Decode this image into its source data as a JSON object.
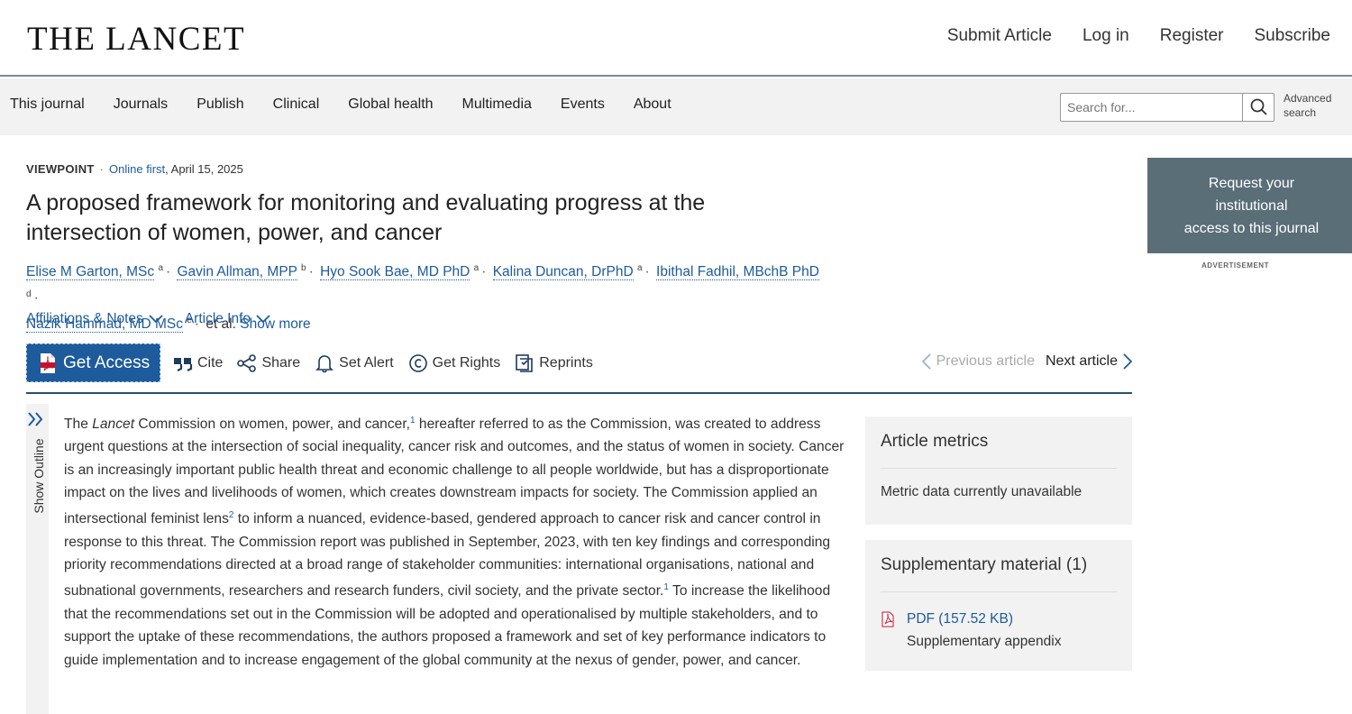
{
  "header": {
    "logo": "THE LANCET",
    "links": [
      "Submit Article",
      "Log in",
      "Register",
      "Subscribe"
    ]
  },
  "nav": {
    "items": [
      "This journal",
      "Journals",
      "Publish",
      "Clinical",
      "Global health",
      "Multimedia",
      "Events",
      "About"
    ],
    "search_placeholder": "Search for...",
    "advanced_search": [
      "Advanced",
      "search"
    ]
  },
  "article": {
    "type": "VIEWPOINT",
    "status": "Online first",
    "date": ", April 15, 2025",
    "title": "A proposed framework for monitoring and evaluating progress at the intersection of women, power, and cancer",
    "authors": [
      {
        "name": "Elise M Garton, MSc",
        "sup": "a"
      },
      {
        "name": "Gavin Allman, MPP",
        "sup": "b"
      },
      {
        "name": "Hyo Sook Bae, MD PhD",
        "sup": "a"
      },
      {
        "name": "Kalina Duncan, DrPhD",
        "sup": "a"
      },
      {
        "name": "Ibithal Fadhil, MBchB PhD",
        "sup": "d"
      },
      {
        "name": "Nazik Hammad, MD MSc",
        "sup": "e"
      }
    ],
    "et_al": "et al.",
    "show_more": "Show more",
    "affiliations": "Affiliations & Notes",
    "article_info": "Article Info"
  },
  "toolbar": {
    "get_access": "Get Access",
    "cite": "Cite",
    "share": "Share",
    "set_alert": "Set Alert",
    "get_rights": "Get Rights",
    "reprints": "Reprints",
    "previous": "Previous article",
    "next": "Next article"
  },
  "outline": {
    "label": "Show Outline"
  },
  "body": {
    "p1_a": "The ",
    "lancet_italic": "Lancet",
    "p1_b": " Commission on women, power, and cancer,",
    "ref1": "1",
    "p1_c": " hereafter referred to as the Commission, was created to address urgent questions at the intersection of social inequality, cancer risk and outcomes, and the status of women in society. Cancer is an increasingly important public health threat and economic challenge to all people worldwide, but has a disproportionate impact on the lives and livelihoods of women, which creates downstream impacts for society. The Commission applied an intersectional feminist lens",
    "ref2": "2",
    "p1_d": " to inform a nuanced, evidence-based, gendered approach to cancer risk and cancer control in response to this threat. The Commission report was published in September, 2023, with ten key findings and corresponding priority recommendations directed at a broad range of stakeholder communities: international organisations, national and subnational governments, researchers and research funders, civil society, and the private sector.",
    "ref3": "1",
    "p1_e": " To increase the likelihood that the recommendations set out in the Commission will be adopted and operationalised by multiple stakeholders, and to support the uptake of these recommendations, the authors proposed a framework and set of key performance indicators to guide implementation and to increase engagement of the global community at the nexus of gender, power, and cancer."
  },
  "sidebar": {
    "access_lines": [
      "Request your",
      "institutional",
      "access to this journal"
    ],
    "ad_label": "ADVERTISEMENT",
    "metrics_title": "Article metrics",
    "metrics_text": "Metric data currently unavailable",
    "supp_title": "Supplementary material (1)",
    "supp_link": "PDF (157.52 KB)",
    "supp_desc": "Supplementary appendix"
  },
  "colors": {
    "link": "#1d5b9c",
    "access_button": "#1d5b9c",
    "institutional_box": "#5a6e78",
    "panel_bg": "#f2f2f2"
  }
}
